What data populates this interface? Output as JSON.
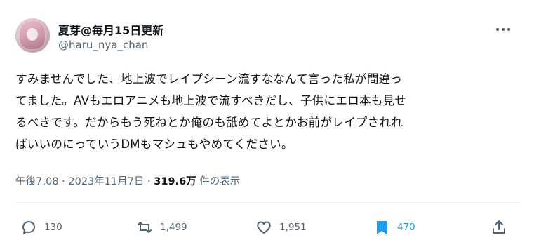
{
  "author": {
    "display_name": "夏芽@毎月15日更新",
    "handle": "@haru_nya_chan"
  },
  "tweet": {
    "lines": [
      "すみませんでした、地上波でレイプシーン流すななんて言った私が間違っ",
      "てました。AVもエロアニメも地上波で流すべきだし、子供にエロ本も見せ",
      "るべきです。だからもう死ねとか俺のも舐めてよとかお前がレイプされれ",
      "ばいいのにっていうDMもマシュもやめてください。"
    ]
  },
  "meta": {
    "time": "午後7:08",
    "sep1": " · ",
    "date": "2023年11月7日",
    "sep2": " · ",
    "views": "319.6万",
    "views_label": " 件の表示"
  },
  "actions": {
    "reply_count": "130",
    "retweet_count": "1,499",
    "like_count": "1,951",
    "bookmark_count": "470"
  },
  "colors": {
    "text": "#0f1419",
    "secondary": "#536471",
    "accent": "#1d9bf0",
    "divider": "#eff3f4"
  },
  "icons": [
    "more-icon",
    "reply-icon",
    "retweet-icon",
    "like-icon",
    "bookmark-icon",
    "share-icon"
  ]
}
